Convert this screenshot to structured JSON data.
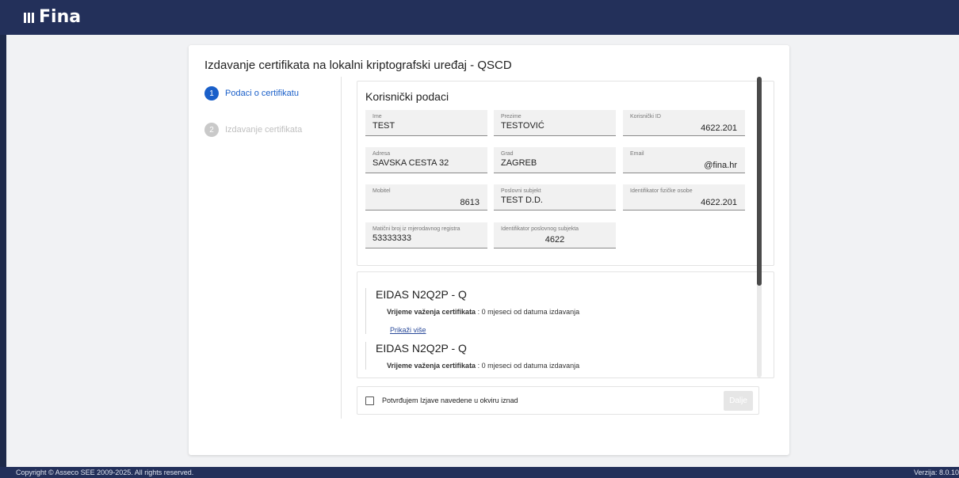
{
  "header": {
    "logo_text": "Fina"
  },
  "page": {
    "title": "Izdavanje certifikata na lokalni kriptografski uređaj - QSCD"
  },
  "steps": [
    {
      "num": "1",
      "label": "Podaci o certifikatu",
      "state": "active"
    },
    {
      "num": "2",
      "label": "Izdavanje certifikata",
      "state": "inactive"
    }
  ],
  "user_data": {
    "heading": "Korisnički podaci",
    "fields": {
      "ime": {
        "label": "Ime",
        "value": "TEST"
      },
      "prezime": {
        "label": "Prezime",
        "value": "TESTOVIĆ"
      },
      "korisnicki_id": {
        "label": "Korisnički ID",
        "value": "4622.201"
      },
      "adresa": {
        "label": "Adresa",
        "value": "SAVSKA CESTA 32"
      },
      "grad": {
        "label": "Grad",
        "value": "ZAGREB"
      },
      "email": {
        "label": "Email",
        "value": "@fina.hr"
      },
      "mobitel": {
        "label": "Mobitel",
        "value": "8613"
      },
      "poslovni_subjekt": {
        "label": "Poslovni subjekt",
        "value": "TEST D.D."
      },
      "identifikator_fizicke": {
        "label": "Identifikator fizičke osobe",
        "value": "4622.201"
      },
      "maticni_broj": {
        "label": "Matični broj iz mjerodavnog registra",
        "value": "53333333"
      },
      "identifikator_poslovnog": {
        "label": "Identifikator poslovnog subjekta",
        "value": "4622"
      }
    }
  },
  "certificates": [
    {
      "title": "EIDAS N2Q2P - Q",
      "validity_label": "Vrijeme važenja certifikata",
      "validity_value": " : 0 mjeseci od datuma izdavanja",
      "more_link": "Prikaži više"
    },
    {
      "title": "EIDAS N2Q2P - Q",
      "validity_label": "Vrijeme važenja certifikata",
      "validity_value": " : 0 mjeseci od datuma izdavanja"
    }
  ],
  "confirm": {
    "label": "Potvrđujem Izjave navedene u okviru iznad",
    "checked": false
  },
  "buttons": {
    "next": "Dalje"
  },
  "footer": {
    "copyright": "Copyright © Asseco SEE 2009-2025. All rights reserved.",
    "version": "Verzija: 8.0.10"
  },
  "colors": {
    "header": "#23305a",
    "accent": "#1a5fc9"
  }
}
